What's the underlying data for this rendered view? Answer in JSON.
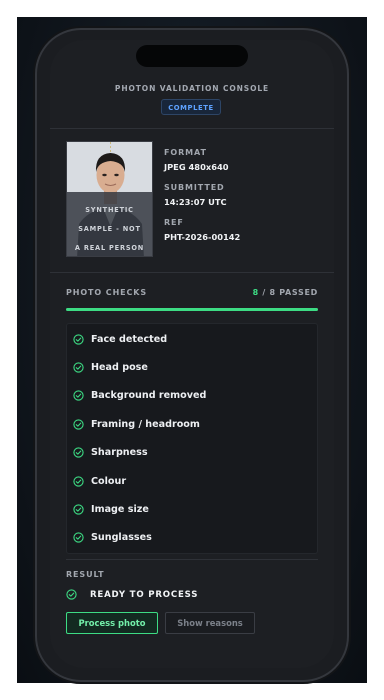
{
  "console": {
    "title": "PHOTON VALIDATION CONSOLE",
    "status": "COMPLETE"
  },
  "photo": {
    "watermark_lines": [
      "SYNTHETIC",
      "SAMPLE - NOT",
      "A REAL PERSON"
    ]
  },
  "meta": {
    "format_label": "FORMAT",
    "format_value": "JPEG 480x640",
    "submitted_label": "SUBMITTED",
    "submitted_value": "14:23:07 UTC",
    "ref_label": "REF",
    "ref_value": "PHT-2026-00142"
  },
  "checks": {
    "header": "PHOTO CHECKS",
    "passed": "8",
    "total_text": " / 8 PASSED",
    "progress_fraction": 1.0,
    "items": [
      {
        "label": "Face detected"
      },
      {
        "label": "Head pose"
      },
      {
        "label": "Background removed"
      },
      {
        "label": "Framing / headroom"
      },
      {
        "label": "Sharpness"
      },
      {
        "label": "Colour"
      },
      {
        "label": "Image size"
      },
      {
        "label": "Sunglasses"
      }
    ]
  },
  "result": {
    "label": "RESULT",
    "status": "READY TO PROCESS",
    "primary_button": "Process photo",
    "secondary_button": "Show reasons"
  },
  "icons": {
    "check": "check-circle-icon"
  },
  "colors": {
    "accent_green": "#3ddc84",
    "badge_blue": "#5ea2ff"
  }
}
